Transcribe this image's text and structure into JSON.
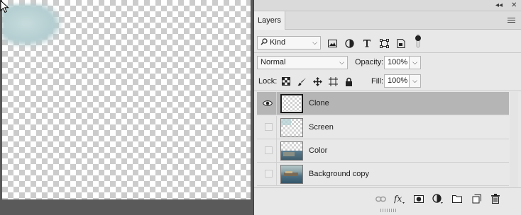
{
  "panel": {
    "collapse_glyph": "◂◂",
    "close_glyph": "✕",
    "tab_label": "Layers"
  },
  "filter": {
    "kind_label": "Kind",
    "chevron": "⌵",
    "icons": [
      "image-filter-icon",
      "adjustment-filter-icon",
      "type-filter-icon",
      "shape-filter-icon",
      "smart-object-filter-icon",
      "filter-toggle-icon"
    ]
  },
  "blend": {
    "mode": "Normal",
    "opacity_label": "Opacity:",
    "opacity_value": "100%"
  },
  "lock": {
    "label": "Lock:",
    "fill_label": "Fill:",
    "fill_value": "100%"
  },
  "layers": [
    {
      "name": "Clone",
      "visible": true,
      "selected": true,
      "thumb": "transparent"
    },
    {
      "name": "Screen",
      "visible": false,
      "selected": false,
      "thumb": "transparent-sky"
    },
    {
      "name": "Color",
      "visible": false,
      "selected": false,
      "thumb": "photo-partial"
    },
    {
      "name": "Background copy",
      "visible": false,
      "selected": false,
      "thumb": "photo-full"
    }
  ],
  "colors": {
    "panel_bg": "#e8e8e8",
    "selected_row": "#b5b5b5",
    "workspace": "#535353"
  }
}
